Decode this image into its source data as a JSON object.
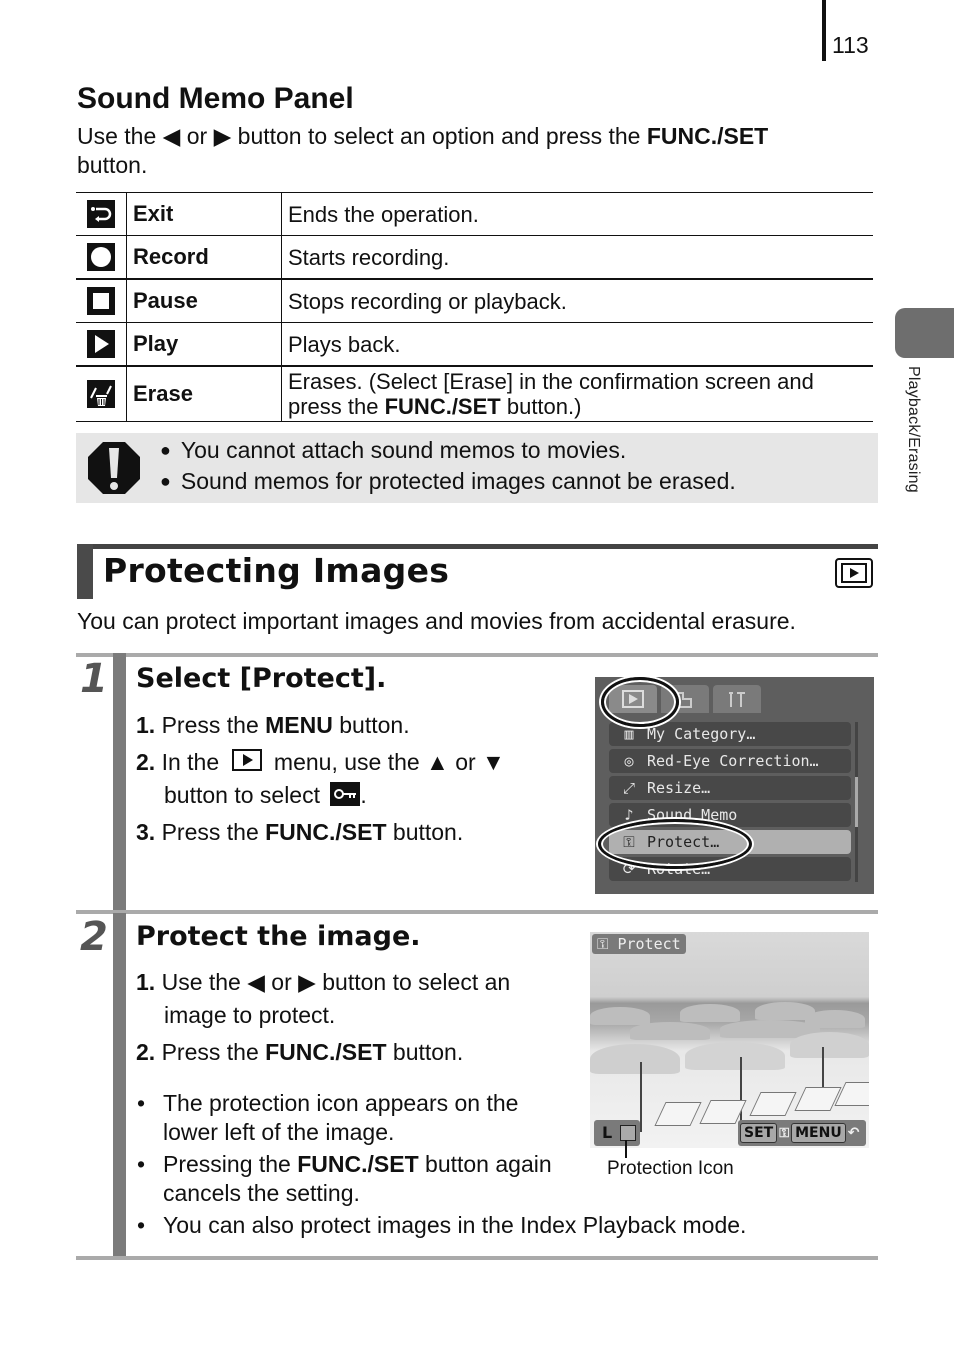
{
  "page": {
    "number": "113",
    "side_tab_label": "Playback/Erasing"
  },
  "sound_memo": {
    "title": "Sound Memo Panel",
    "intro_pre": "Use the ◀ or ▶ button to select an option and press the ",
    "intro_bold": "FUNC./SET",
    "intro_post": " button.",
    "rows": [
      {
        "icon": "exit-icon",
        "name": "Exit",
        "desc": "Ends the operation."
      },
      {
        "icon": "record-icon",
        "name": "Record",
        "desc": "Starts recording."
      },
      {
        "icon": "pause-icon",
        "name": "Pause",
        "desc": "Stops recording or playback."
      },
      {
        "icon": "play-icon",
        "name": "Play",
        "desc": "Plays back."
      },
      {
        "icon": "erase-icon",
        "name": "Erase",
        "desc_pre": "Erases. (Select [Erase] in the confirmation screen and press the ",
        "desc_bold": "FUNC./SET",
        "desc_post": " button.)"
      }
    ]
  },
  "caution": {
    "icon": "caution-icon",
    "items": [
      "You cannot attach sound memos to movies.",
      "Sound memos for protected images cannot be erased."
    ]
  },
  "protecting": {
    "title": "Protecting Images",
    "mode_icon": "playback-mode-icon",
    "description": "You can protect important images and movies from accidental erasure.",
    "steps": [
      {
        "number": "1",
        "title": "Select [Protect].",
        "substeps": [
          {
            "n": "1.",
            "pre": "Press the ",
            "bold": "MENU",
            "post": " button."
          },
          {
            "n": "2.",
            "pre": "In the ",
            "mid": " menu, use the ▲ or ▼",
            "line2": "button to select ",
            "end": "."
          },
          {
            "n": "3.",
            "pre": "Press the ",
            "bold": "FUNC./SET",
            "post": " button."
          }
        ],
        "screen": {
          "tabs": [
            "playback-tab-icon",
            "print-tab-icon",
            "setup-tab-icon"
          ],
          "menu_items": [
            {
              "icon": "my-category-icon",
              "label": "My Category…"
            },
            {
              "icon": "red-eye-icon",
              "label": "Red-Eye Correction…"
            },
            {
              "icon": "resize-icon",
              "label": "Resize…"
            },
            {
              "icon": "sound-memo-icon",
              "label": "Sound Memo"
            },
            {
              "icon": "key-icon",
              "label": "Protect…",
              "selected": true
            },
            {
              "icon": "rotate-icon",
              "label": "Rotate…"
            }
          ]
        }
      },
      {
        "number": "2",
        "title": "Protect the image.",
        "substeps": [
          {
            "n": "1.",
            "pre": "Use the ◀ or ▶ button to select an",
            "line2": "image to protect."
          },
          {
            "n": "2.",
            "pre": "Press the ",
            "bold": "FUNC./SET",
            "post": " button."
          }
        ],
        "bullets": [
          {
            "text": "The protection icon appears on the lower left of the image."
          },
          {
            "pre": "Pressing the ",
            "bold": "FUNC./SET",
            "post": " button again cancels the setting."
          },
          {
            "text": "You can also protect images in the Index Playback mode."
          }
        ],
        "screen": {
          "badge": "Protect",
          "bottom_left": "L",
          "set_label": "SET",
          "menu_label": "MENU"
        },
        "callout": "Protection Icon"
      }
    ]
  }
}
